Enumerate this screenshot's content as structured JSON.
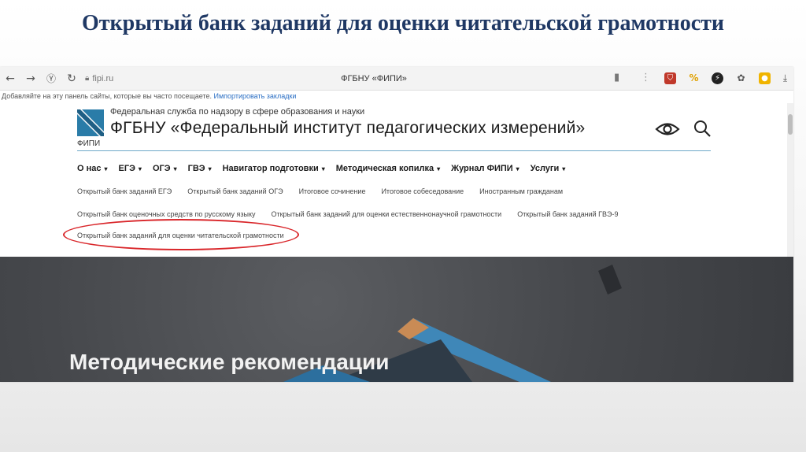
{
  "slide": {
    "title": "Открытый банк заданий для оценки читательской грамотности"
  },
  "browser": {
    "url": "fipi.ru",
    "tab_title": "ФГБНУ «ФИПИ»",
    "bookmarks_bar": {
      "text": "Добавляйте на эту панель сайты, которые вы часто посещаете.",
      "link": "Импортировать закладки"
    },
    "icons": [
      "back-icon",
      "forward-icon",
      "yandex-icon",
      "reload-icon",
      "lock-icon",
      "bookmark-icon",
      "more-icon"
    ],
    "extensions": [
      {
        "name": "ublock-extension",
        "glyph": "⛉",
        "color": "#c0392b"
      },
      {
        "name": "percent-extension",
        "glyph": "%",
        "color": "#e0a100"
      },
      {
        "name": "shield-extension",
        "glyph": "⚡",
        "color": "#222222"
      },
      {
        "name": "puzzle-extension",
        "glyph": "✿",
        "color": "#555555"
      },
      {
        "name": "profile-extension",
        "glyph": "●",
        "color": "#f0b400"
      },
      {
        "name": "download-icon",
        "glyph": "⤓",
        "color": "#555555"
      }
    ]
  },
  "site": {
    "gov_line": "Федеральная служба по надзору в сфере образования и науки",
    "org_name": "ФГБНУ «Федеральный институт педагогических измерений»",
    "fipi_label": "ФИПИ",
    "accent_color": "#2a7ca8",
    "nav_main": [
      {
        "label": "О нас",
        "caret": "▾"
      },
      {
        "label": "ЕГЭ",
        "caret": "▾"
      },
      {
        "label": "ОГЭ",
        "caret": "▾"
      },
      {
        "label": "ГВЭ",
        "caret": "▾"
      },
      {
        "label": "Навигатор подготовки",
        "caret": "▾"
      },
      {
        "label": "Методическая копилка",
        "caret": "▾"
      },
      {
        "label": "Журнал ФИПИ",
        "caret": "▾"
      },
      {
        "label": "Услуги",
        "caret": "▾"
      }
    ],
    "sub_row_1": [
      "Открытый банк заданий ЕГЭ",
      "Открытый банк заданий ОГЭ",
      "Итоговое сочинение",
      "Итоговое собеседование",
      "Иностранным гражданам"
    ],
    "sub_row_2": [
      "Открытый банк оценочных средств по русскому языку",
      "Открытый банк заданий для оценки естественнонаучной грамотности",
      "Открытый банк заданий ГВЭ-9"
    ],
    "sub_row_3": [
      "Открытый банк заданий для оценки читательской грамотности"
    ],
    "highlight_color": "#d9262a"
  },
  "hero": {
    "title": "Методические рекомендации"
  }
}
